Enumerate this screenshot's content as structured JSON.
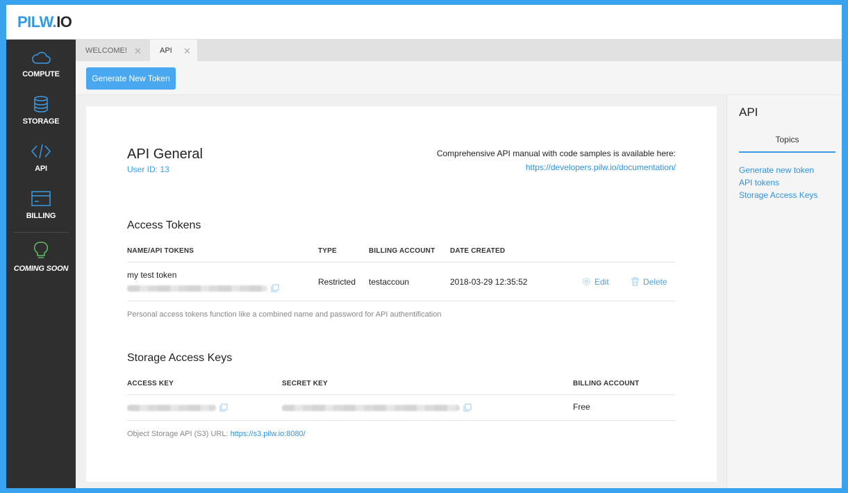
{
  "app": {
    "logo_part1": "PILW.",
    "logo_part2": "IO"
  },
  "sidebar": {
    "items": [
      {
        "label": "COMPUTE",
        "icon": "cloud-icon"
      },
      {
        "label": "STORAGE",
        "icon": "database-icon"
      },
      {
        "label": "API",
        "icon": "code-icon",
        "active": true
      },
      {
        "label": "BILLING",
        "icon": "credit-card-icon"
      },
      {
        "label": "COMING SOON",
        "icon": "lightbulb-icon"
      }
    ]
  },
  "tabs": [
    {
      "label": "WELCOME!",
      "active": false
    },
    {
      "label": "API",
      "active": true
    }
  ],
  "toolbar": {
    "generate_label": "Generate New Token"
  },
  "api_general": {
    "title": "API General",
    "user_id": "User ID: 13",
    "manual_text": "Comprehensive API manual with code samples is available here:",
    "manual_link": "https://developers.pilw.io/documentation/"
  },
  "access_tokens": {
    "title": "Access Tokens",
    "columns": [
      "NAME/API TOKENS",
      "TYPE",
      "BILLING ACCOUNT",
      "DATE CREATED"
    ],
    "rows": [
      {
        "name": "my test token",
        "type": "Restricted",
        "billing_account": "testaccoun",
        "date_created": "2018-03-29 12:35:52",
        "edit_label": "Edit",
        "delete_label": "Delete"
      }
    ],
    "note": "Personal access tokens function like a combined name and password for API authentification"
  },
  "storage_keys": {
    "title": "Storage Access Keys",
    "columns": [
      "ACCESS KEY",
      "SECRET KEY",
      "BILLING ACCOUNT"
    ],
    "rows": [
      {
        "billing_account": "Free"
      }
    ],
    "note_prefix": "Object Storage API (S3) URL: ",
    "note_link": "https://s3.pilw.io:8080/"
  },
  "right_panel": {
    "title": "API",
    "tab": "Topics",
    "links": [
      "Generate new token",
      "API tokens",
      "Storage Access Keys"
    ]
  },
  "colors": {
    "accent": "#3aa3f0",
    "sidebar_bg": "#2f2f30",
    "active_icon": "#3a9be6",
    "soon_icon": "#5fbf5f"
  }
}
